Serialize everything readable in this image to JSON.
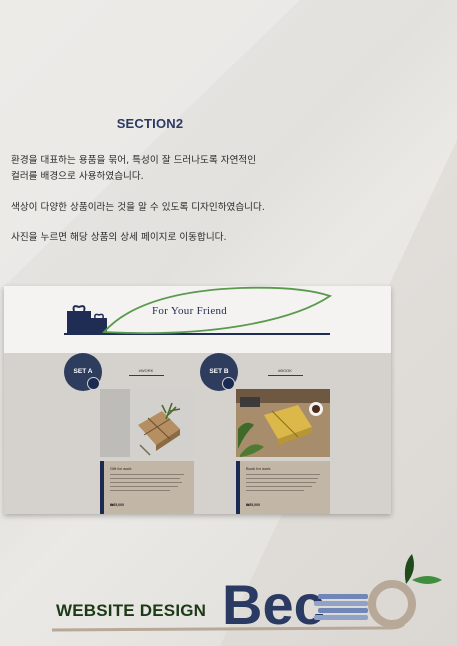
{
  "section": {
    "title": "SECTION2"
  },
  "description": {
    "line1": "환경을 대표하는 용품을 묶어, 특성이 잘 드러나도록 자연적인",
    "line2": "컬러를 배경으로 사용하였습니다.",
    "line3": "색상이 다양한 상품이라는 것을 알 수 있도록 디자인하였습니다.",
    "line4": "사진을 누르면 해당 상품의 상세 페이지로 이동합니다."
  },
  "mockup": {
    "header_title": "For Your Friend",
    "sets": [
      {
        "label": "SET A",
        "tag": "#WORK",
        "info_title": "Gift for work",
        "price": "₩65,000"
      },
      {
        "label": "SET B",
        "tag": "#BOOK",
        "info_title": "Book for work",
        "price": "₩55,000"
      }
    ]
  },
  "footer": {
    "label": "WEBSITE DESIGN",
    "logo_text": "Bec"
  },
  "colors": {
    "navy": "#2e3c5e",
    "green": "#1d3a17",
    "leaf_green": "#3f8d3d",
    "beige": "#c2b6a7"
  }
}
